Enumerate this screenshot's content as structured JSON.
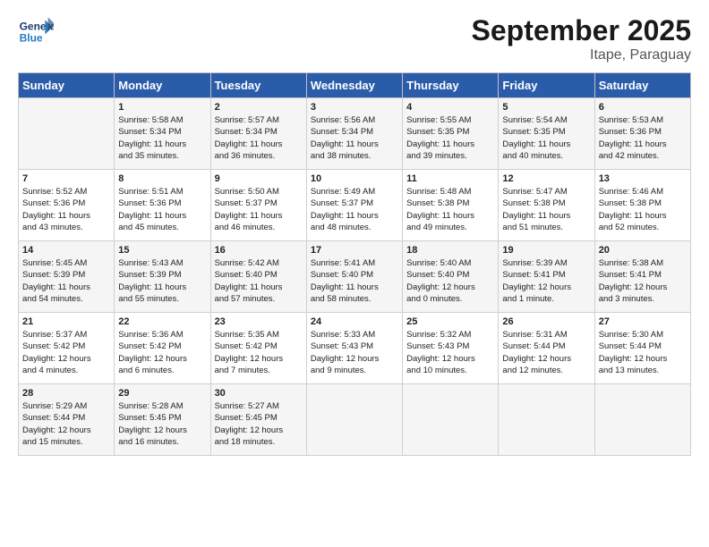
{
  "header": {
    "logo_text_1": "General",
    "logo_text_2": "Blue",
    "month": "September 2025",
    "location": "Itape, Paraguay"
  },
  "columns": [
    "Sunday",
    "Monday",
    "Tuesday",
    "Wednesday",
    "Thursday",
    "Friday",
    "Saturday"
  ],
  "weeks": [
    [
      {
        "day": "",
        "lines": []
      },
      {
        "day": "1",
        "lines": [
          "Sunrise: 5:58 AM",
          "Sunset: 5:34 PM",
          "Daylight: 11 hours",
          "and 35 minutes."
        ]
      },
      {
        "day": "2",
        "lines": [
          "Sunrise: 5:57 AM",
          "Sunset: 5:34 PM",
          "Daylight: 11 hours",
          "and 36 minutes."
        ]
      },
      {
        "day": "3",
        "lines": [
          "Sunrise: 5:56 AM",
          "Sunset: 5:34 PM",
          "Daylight: 11 hours",
          "and 38 minutes."
        ]
      },
      {
        "day": "4",
        "lines": [
          "Sunrise: 5:55 AM",
          "Sunset: 5:35 PM",
          "Daylight: 11 hours",
          "and 39 minutes."
        ]
      },
      {
        "day": "5",
        "lines": [
          "Sunrise: 5:54 AM",
          "Sunset: 5:35 PM",
          "Daylight: 11 hours",
          "and 40 minutes."
        ]
      },
      {
        "day": "6",
        "lines": [
          "Sunrise: 5:53 AM",
          "Sunset: 5:36 PM",
          "Daylight: 11 hours",
          "and 42 minutes."
        ]
      }
    ],
    [
      {
        "day": "7",
        "lines": [
          "Sunrise: 5:52 AM",
          "Sunset: 5:36 PM",
          "Daylight: 11 hours",
          "and 43 minutes."
        ]
      },
      {
        "day": "8",
        "lines": [
          "Sunrise: 5:51 AM",
          "Sunset: 5:36 PM",
          "Daylight: 11 hours",
          "and 45 minutes."
        ]
      },
      {
        "day": "9",
        "lines": [
          "Sunrise: 5:50 AM",
          "Sunset: 5:37 PM",
          "Daylight: 11 hours",
          "and 46 minutes."
        ]
      },
      {
        "day": "10",
        "lines": [
          "Sunrise: 5:49 AM",
          "Sunset: 5:37 PM",
          "Daylight: 11 hours",
          "and 48 minutes."
        ]
      },
      {
        "day": "11",
        "lines": [
          "Sunrise: 5:48 AM",
          "Sunset: 5:38 PM",
          "Daylight: 11 hours",
          "and 49 minutes."
        ]
      },
      {
        "day": "12",
        "lines": [
          "Sunrise: 5:47 AM",
          "Sunset: 5:38 PM",
          "Daylight: 11 hours",
          "and 51 minutes."
        ]
      },
      {
        "day": "13",
        "lines": [
          "Sunrise: 5:46 AM",
          "Sunset: 5:38 PM",
          "Daylight: 11 hours",
          "and 52 minutes."
        ]
      }
    ],
    [
      {
        "day": "14",
        "lines": [
          "Sunrise: 5:45 AM",
          "Sunset: 5:39 PM",
          "Daylight: 11 hours",
          "and 54 minutes."
        ]
      },
      {
        "day": "15",
        "lines": [
          "Sunrise: 5:43 AM",
          "Sunset: 5:39 PM",
          "Daylight: 11 hours",
          "and 55 minutes."
        ]
      },
      {
        "day": "16",
        "lines": [
          "Sunrise: 5:42 AM",
          "Sunset: 5:40 PM",
          "Daylight: 11 hours",
          "and 57 minutes."
        ]
      },
      {
        "day": "17",
        "lines": [
          "Sunrise: 5:41 AM",
          "Sunset: 5:40 PM",
          "Daylight: 11 hours",
          "and 58 minutes."
        ]
      },
      {
        "day": "18",
        "lines": [
          "Sunrise: 5:40 AM",
          "Sunset: 5:40 PM",
          "Daylight: 12 hours",
          "and 0 minutes."
        ]
      },
      {
        "day": "19",
        "lines": [
          "Sunrise: 5:39 AM",
          "Sunset: 5:41 PM",
          "Daylight: 12 hours",
          "and 1 minute."
        ]
      },
      {
        "day": "20",
        "lines": [
          "Sunrise: 5:38 AM",
          "Sunset: 5:41 PM",
          "Daylight: 12 hours",
          "and 3 minutes."
        ]
      }
    ],
    [
      {
        "day": "21",
        "lines": [
          "Sunrise: 5:37 AM",
          "Sunset: 5:42 PM",
          "Daylight: 12 hours",
          "and 4 minutes."
        ]
      },
      {
        "day": "22",
        "lines": [
          "Sunrise: 5:36 AM",
          "Sunset: 5:42 PM",
          "Daylight: 12 hours",
          "and 6 minutes."
        ]
      },
      {
        "day": "23",
        "lines": [
          "Sunrise: 5:35 AM",
          "Sunset: 5:42 PM",
          "Daylight: 12 hours",
          "and 7 minutes."
        ]
      },
      {
        "day": "24",
        "lines": [
          "Sunrise: 5:33 AM",
          "Sunset: 5:43 PM",
          "Daylight: 12 hours",
          "and 9 minutes."
        ]
      },
      {
        "day": "25",
        "lines": [
          "Sunrise: 5:32 AM",
          "Sunset: 5:43 PM",
          "Daylight: 12 hours",
          "and 10 minutes."
        ]
      },
      {
        "day": "26",
        "lines": [
          "Sunrise: 5:31 AM",
          "Sunset: 5:44 PM",
          "Daylight: 12 hours",
          "and 12 minutes."
        ]
      },
      {
        "day": "27",
        "lines": [
          "Sunrise: 5:30 AM",
          "Sunset: 5:44 PM",
          "Daylight: 12 hours",
          "and 13 minutes."
        ]
      }
    ],
    [
      {
        "day": "28",
        "lines": [
          "Sunrise: 5:29 AM",
          "Sunset: 5:44 PM",
          "Daylight: 12 hours",
          "and 15 minutes."
        ]
      },
      {
        "day": "29",
        "lines": [
          "Sunrise: 5:28 AM",
          "Sunset: 5:45 PM",
          "Daylight: 12 hours",
          "and 16 minutes."
        ]
      },
      {
        "day": "30",
        "lines": [
          "Sunrise: 5:27 AM",
          "Sunset: 5:45 PM",
          "Daylight: 12 hours",
          "and 18 minutes."
        ]
      },
      {
        "day": "",
        "lines": []
      },
      {
        "day": "",
        "lines": []
      },
      {
        "day": "",
        "lines": []
      },
      {
        "day": "",
        "lines": []
      }
    ]
  ]
}
